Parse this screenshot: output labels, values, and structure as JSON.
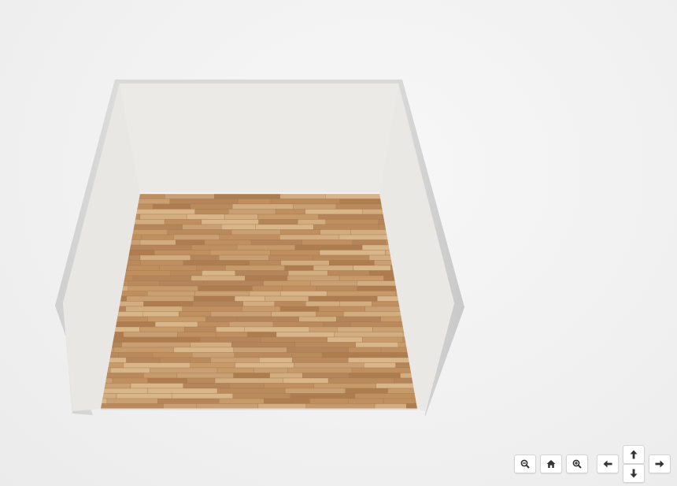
{
  "scene": {
    "background_color": "#f2f2f2",
    "wall_color": "#ebeae6",
    "wall_edge_color": "#d6d6d6",
    "floor_base_color": "#c49a6c",
    "floor_material": "light-oak-laminate"
  },
  "controls": {
    "zoom_out": {
      "icon": "zoom-out-icon"
    },
    "home": {
      "icon": "home-icon"
    },
    "zoom_in": {
      "icon": "zoom-in-icon"
    },
    "pan_left": {
      "icon": "arrow-left-icon"
    },
    "pan_up": {
      "icon": "arrow-up-icon"
    },
    "pan_down": {
      "icon": "arrow-down-icon"
    },
    "pan_right": {
      "icon": "arrow-right-icon"
    }
  }
}
